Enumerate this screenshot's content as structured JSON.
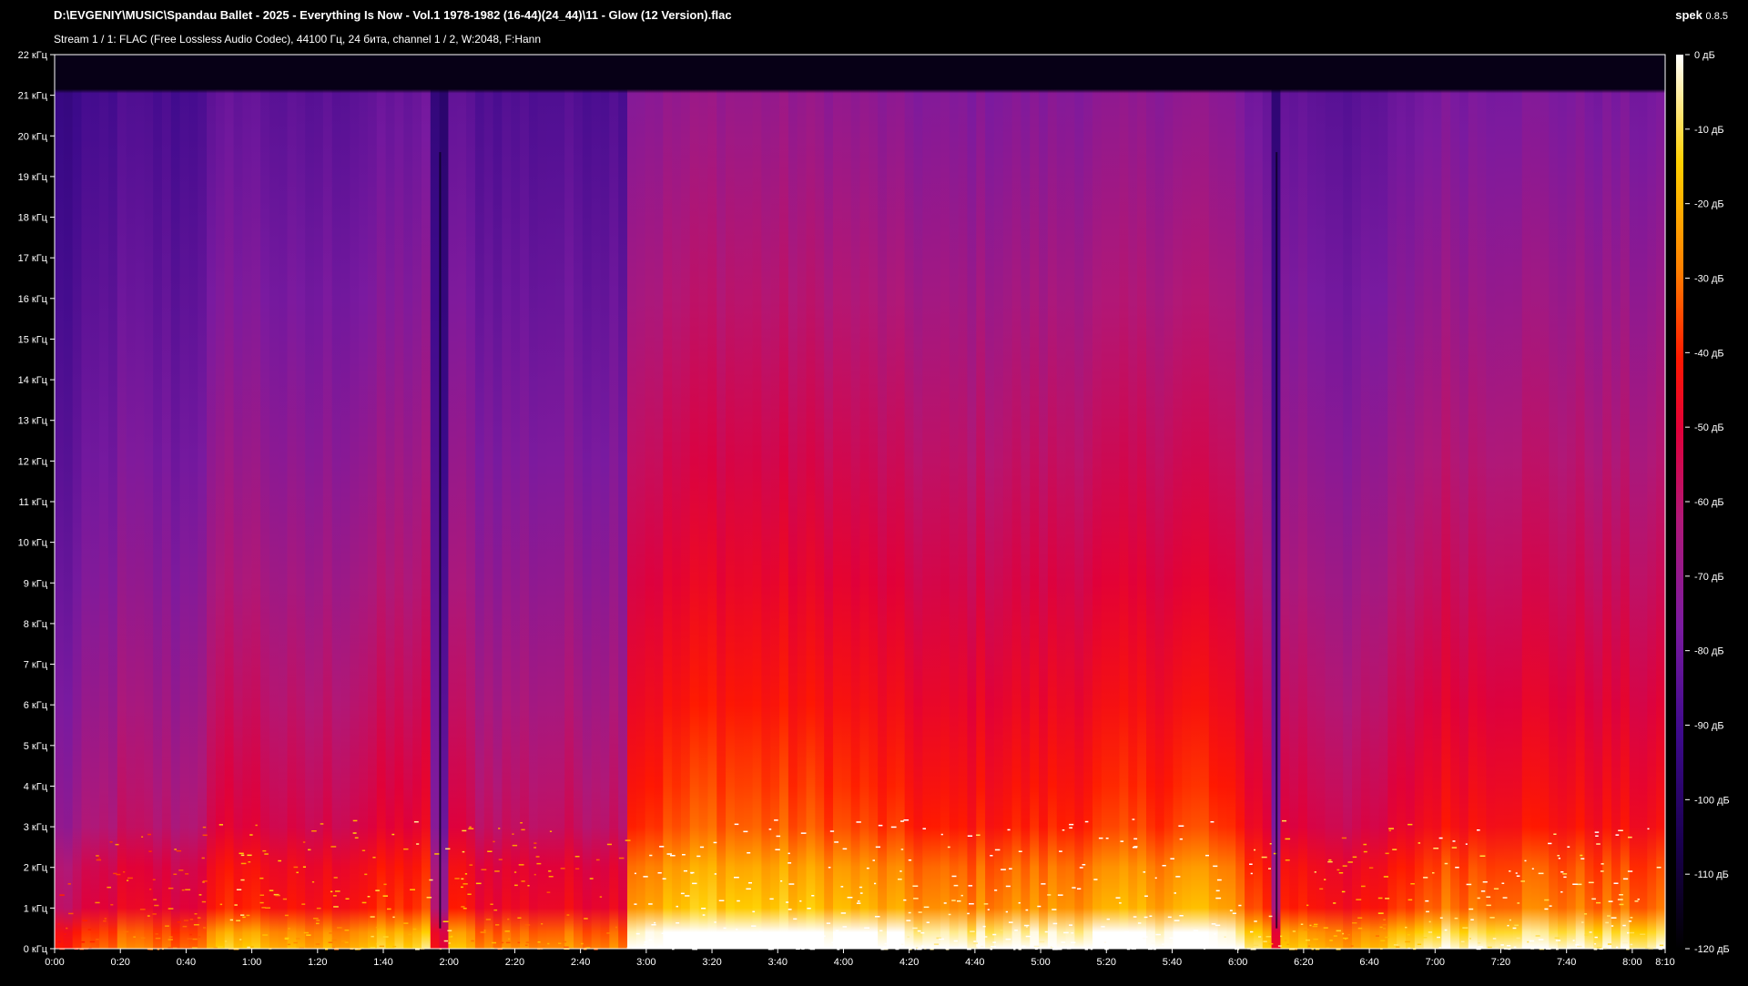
{
  "header": {
    "file_path": "D:\\EVGENIY\\MUSIC\\Spandau Ballet - 2025 - Everything Is Now - Vol.1 1978-1982 (16-44)(24_44)\\11 - Glow (12 Version).flac",
    "stream_info": "Stream 1 / 1: FLAC (Free Lossless Audio Codec), 44100 Гц, 24 бита, channel 1 / 2, W:2048, F:Hann"
  },
  "app": {
    "name": "spek",
    "version": "0.8.5"
  },
  "chart_data": {
    "type": "heatmap",
    "x_ticks": [
      "0:00",
      "0:20",
      "0:40",
      "1:00",
      "1:20",
      "1:40",
      "2:00",
      "2:20",
      "2:40",
      "3:00",
      "3:20",
      "3:40",
      "4:00",
      "4:20",
      "4:40",
      "5:00",
      "5:20",
      "5:40",
      "6:00",
      "6:20",
      "6:40",
      "7:00",
      "7:20",
      "7:40",
      "8:00",
      "8:10"
    ],
    "x_range_seconds": [
      0,
      490
    ],
    "y_ticks": [
      "0 кГц",
      "1 кГц",
      "2 кГц",
      "3 кГц",
      "4 кГц",
      "5 кГц",
      "6 кГц",
      "7 кГц",
      "8 кГц",
      "9 кГц",
      "10 кГц",
      "11 кГц",
      "12 кГц",
      "13 кГц",
      "14 кГц",
      "15 кГц",
      "16 кГц",
      "17 кГц",
      "18 кГц",
      "19 кГц",
      "20 кГц",
      "21 кГц",
      "22 кГц"
    ],
    "y_range_khz": [
      0,
      22
    ],
    "content_cutoff_khz": 21.1,
    "colorbar_ticks": [
      "0 дБ",
      "-10 дБ",
      "-20 дБ",
      "-30 дБ",
      "-40 дБ",
      "-50 дБ",
      "-60 дБ",
      "-70 дБ",
      "-80 дБ",
      "-90 дБ",
      "-100 дБ",
      "-110 дБ",
      "-120 дБ"
    ],
    "colorbar_range_db": [
      -120,
      0
    ],
    "colormap": [
      "#000000",
      "#1a0050",
      "#3d0a8c",
      "#7a1aa0",
      "#b01878",
      "#e0003a",
      "#ff1800",
      "#ff8000",
      "#ffd000",
      "#ffffff"
    ],
    "loudness_profile": [
      {
        "t": 0,
        "level": 0.45
      },
      {
        "t": 8,
        "level": 0.5
      },
      {
        "t": 20,
        "level": 0.58
      },
      {
        "t": 40,
        "level": 0.55
      },
      {
        "t": 55,
        "level": 0.7
      },
      {
        "t": 75,
        "level": 0.62
      },
      {
        "t": 100,
        "level": 0.68
      },
      {
        "t": 115,
        "level": 0.72
      },
      {
        "t": 130,
        "level": 0.6
      },
      {
        "t": 150,
        "level": 0.6
      },
      {
        "t": 173,
        "level": 0.6
      },
      {
        "t": 175,
        "level": 0.84
      },
      {
        "t": 200,
        "level": 0.92
      },
      {
        "t": 240,
        "level": 0.88
      },
      {
        "t": 270,
        "level": 0.8
      },
      {
        "t": 300,
        "level": 0.82
      },
      {
        "t": 320,
        "level": 0.85
      },
      {
        "t": 350,
        "level": 0.88
      },
      {
        "t": 370,
        "level": 0.7
      },
      {
        "t": 400,
        "level": 0.62
      },
      {
        "t": 420,
        "level": 0.78
      },
      {
        "t": 450,
        "level": 0.8
      },
      {
        "t": 490,
        "level": 0.75
      }
    ],
    "dark_lines_seconds": [
      117,
      371.5
    ]
  }
}
